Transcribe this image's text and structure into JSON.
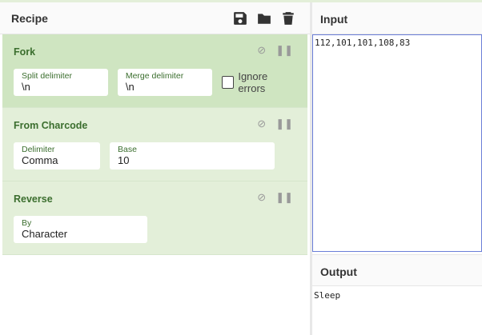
{
  "recipe": {
    "title": "Recipe",
    "icons": [
      "save-icon",
      "folder-icon",
      "trash-icon"
    ],
    "operations": [
      {
        "title": "Fork",
        "fields": [
          {
            "label": "Split delimiter",
            "value": "\\n"
          },
          {
            "label": "Merge delimiter",
            "value": "\\n"
          }
        ],
        "checkbox": "Ignore errors"
      },
      {
        "title": "From Charcode",
        "fields": [
          {
            "label": "Delimiter",
            "value": "Comma"
          },
          {
            "label": "Base",
            "value": "10"
          }
        ]
      },
      {
        "title": "Reverse",
        "fields": [
          {
            "label": "By",
            "value": "Character"
          }
        ]
      }
    ]
  },
  "input": {
    "title": "Input",
    "value": "112,101,101,108,83"
  },
  "output": {
    "title": "Output",
    "value": "Sleep"
  }
}
